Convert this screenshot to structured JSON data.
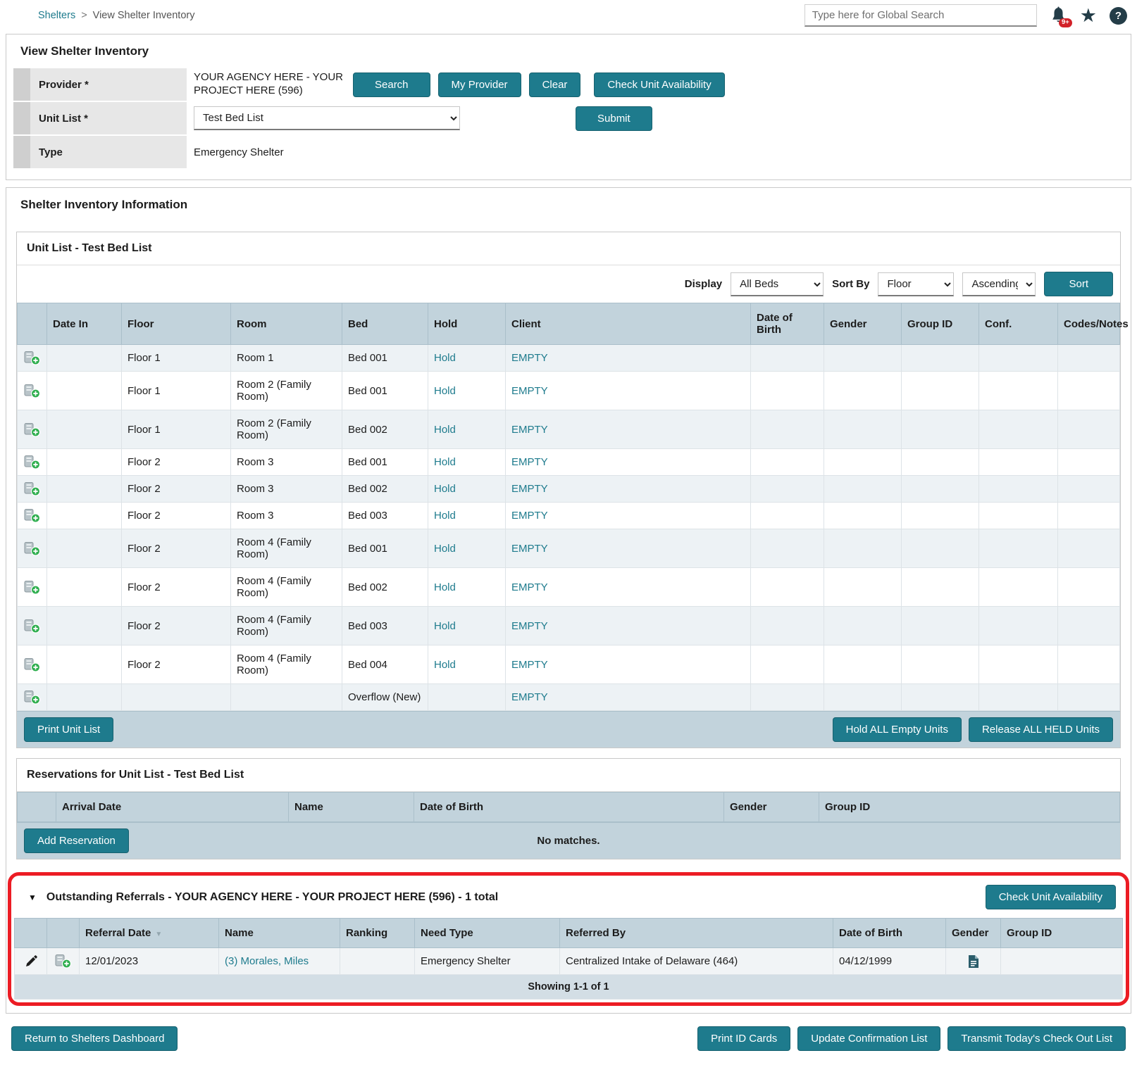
{
  "topbar": {
    "breadcrumb": {
      "home": "Shelters",
      "separator": ">",
      "current": "View Shelter Inventory"
    },
    "search_placeholder": "Type here for Global Search",
    "notification_count": "9+",
    "help_glyph": "?",
    "star_glyph": "★"
  },
  "colors": {
    "teal": "#1e7b8d",
    "steel_header": "#c2d3dc",
    "row_alt": "#edf2f5",
    "annotation_red": "#ec1c24",
    "link": "#1e7b8d"
  },
  "inventory_form": {
    "title": "View Shelter Inventory",
    "provider_label": "Provider *",
    "provider_value": "YOUR AGENCY HERE - YOUR PROJECT HERE (596)",
    "unit_list_label": "Unit List *",
    "unit_list_value": "Test Bed List",
    "type_label": "Type",
    "type_value": "Emergency Shelter",
    "buttons": {
      "search": "Search",
      "my_provider": "My Provider",
      "clear": "Clear",
      "check_unit_availability": "Check Unit Availability",
      "submit": "Submit"
    }
  },
  "inventory_info": {
    "title": "Shelter Inventory Information",
    "unit_list_panel": {
      "title": "Unit List - Test Bed List",
      "display_label": "Display",
      "display_value": "All Beds",
      "sort_by_label": "Sort By",
      "sort_field_value": "Floor",
      "sort_order_value": "Ascending",
      "sort_button": "Sort",
      "columns": [
        "Date In",
        "Floor",
        "Room",
        "Bed",
        "Hold",
        "Client",
        "Date of Birth",
        "Gender",
        "Group ID",
        "Conf.",
        "Codes/Notes"
      ],
      "rows": [
        {
          "date_in": "",
          "floor": "Floor 1",
          "room": "Room 1",
          "bed": "Bed 001",
          "hold": "Hold",
          "client": "EMPTY",
          "dob": "",
          "gender": "",
          "group_id": "",
          "conf": "",
          "codes": ""
        },
        {
          "date_in": "",
          "floor": "Floor 1",
          "room": "Room 2 (Family Room)",
          "bed": "Bed 001",
          "hold": "Hold",
          "client": "EMPTY",
          "dob": "",
          "gender": "",
          "group_id": "",
          "conf": "",
          "codes": ""
        },
        {
          "date_in": "",
          "floor": "Floor 1",
          "room": "Room 2 (Family Room)",
          "bed": "Bed 002",
          "hold": "Hold",
          "client": "EMPTY",
          "dob": "",
          "gender": "",
          "group_id": "",
          "conf": "",
          "codes": ""
        },
        {
          "date_in": "",
          "floor": "Floor 2",
          "room": "Room 3",
          "bed": "Bed 001",
          "hold": "Hold",
          "client": "EMPTY",
          "dob": "",
          "gender": "",
          "group_id": "",
          "conf": "",
          "codes": ""
        },
        {
          "date_in": "",
          "floor": "Floor 2",
          "room": "Room 3",
          "bed": "Bed 002",
          "hold": "Hold",
          "client": "EMPTY",
          "dob": "",
          "gender": "",
          "group_id": "",
          "conf": "",
          "codes": ""
        },
        {
          "date_in": "",
          "floor": "Floor 2",
          "room": "Room 3",
          "bed": "Bed 003",
          "hold": "Hold",
          "client": "EMPTY",
          "dob": "",
          "gender": "",
          "group_id": "",
          "conf": "",
          "codes": ""
        },
        {
          "date_in": "",
          "floor": "Floor 2",
          "room": "Room 4 (Family Room)",
          "bed": "Bed 001",
          "hold": "Hold",
          "client": "EMPTY",
          "dob": "",
          "gender": "",
          "group_id": "",
          "conf": "",
          "codes": ""
        },
        {
          "date_in": "",
          "floor": "Floor 2",
          "room": "Room 4 (Family Room)",
          "bed": "Bed 002",
          "hold": "Hold",
          "client": "EMPTY",
          "dob": "",
          "gender": "",
          "group_id": "",
          "conf": "",
          "codes": ""
        },
        {
          "date_in": "",
          "floor": "Floor 2",
          "room": "Room 4 (Family Room)",
          "bed": "Bed 003",
          "hold": "Hold",
          "client": "EMPTY",
          "dob": "",
          "gender": "",
          "group_id": "",
          "conf": "",
          "codes": ""
        },
        {
          "date_in": "",
          "floor": "Floor 2",
          "room": "Room 4 (Family Room)",
          "bed": "Bed 004",
          "hold": "Hold",
          "client": "EMPTY",
          "dob": "",
          "gender": "",
          "group_id": "",
          "conf": "",
          "codes": ""
        },
        {
          "date_in": "",
          "floor": "",
          "room": "",
          "bed": "Overflow (New)",
          "hold": "",
          "client": "EMPTY",
          "dob": "",
          "gender": "",
          "group_id": "",
          "conf": "",
          "codes": ""
        }
      ],
      "print_button": "Print Unit List",
      "hold_all_button": "Hold ALL Empty Units",
      "release_all_button": "Release ALL HELD Units"
    },
    "reservations_panel": {
      "title": "Reservations for Unit List - Test Bed List",
      "columns": [
        "Arrival Date",
        "Name",
        "Date of Birth",
        "Gender",
        "Group ID"
      ],
      "add_button": "Add Reservation",
      "no_matches": "No matches."
    },
    "referrals_panel": {
      "title": "Outstanding Referrals - YOUR AGENCY HERE - YOUR PROJECT HERE (596) - 1 total",
      "collapse_glyph": "▼",
      "sort_indicator": "▼",
      "check_unit_availability_button": "Check Unit Availability",
      "columns": [
        "Referral Date",
        "Name",
        "Ranking",
        "Need Type",
        "Referred By",
        "Date of Birth",
        "Gender",
        "Group ID"
      ],
      "rows": [
        {
          "referral_date": "12/01/2023",
          "name": "(3) Morales, Miles",
          "ranking": "",
          "need_type": "Emergency Shelter",
          "referred_by": "Centralized Intake of Delaware (464)",
          "dob": "04/12/1999",
          "group_id": ""
        }
      ],
      "showing": "Showing 1-1 of 1"
    }
  },
  "footer": {
    "return_button": "Return to Shelters Dashboard",
    "print_id_cards_button": "Print ID Cards",
    "update_confirmation_button": "Update Confirmation List",
    "transmit_button": "Transmit Today's Check Out List"
  }
}
